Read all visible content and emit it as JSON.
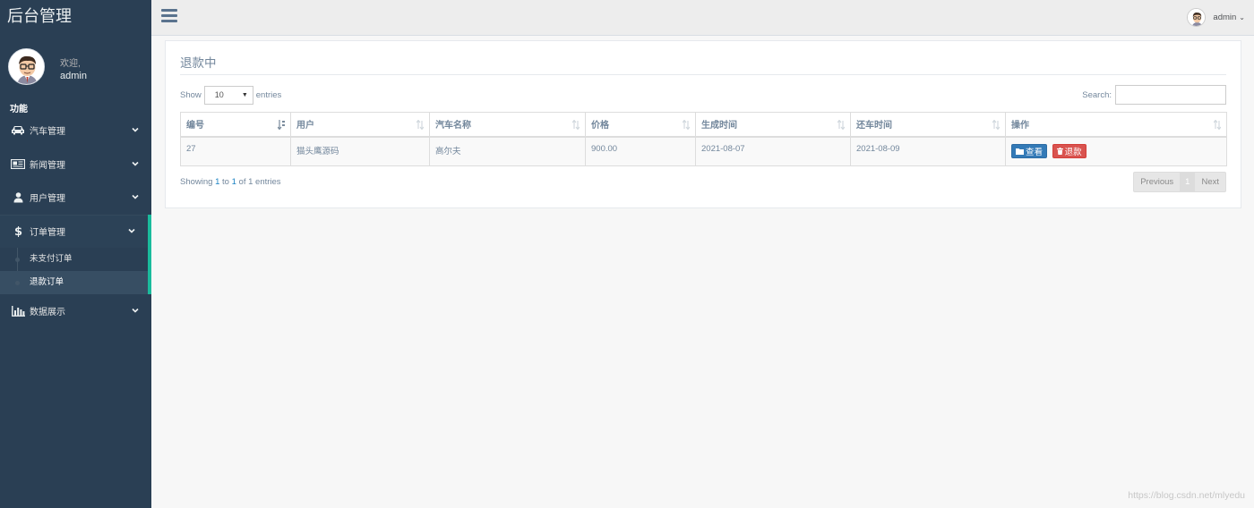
{
  "brand": {
    "title": "后台管理"
  },
  "profile": {
    "welcome": "欢迎,",
    "username": "admin"
  },
  "sidebar": {
    "section_title": "功能",
    "items": [
      {
        "label": "汽车管理",
        "icon": "car-icon"
      },
      {
        "label": "新闻管理",
        "icon": "newspaper-icon"
      },
      {
        "label": "用户管理",
        "icon": "user-icon"
      },
      {
        "label": "订单管理",
        "icon": "dollar-icon",
        "active": true,
        "children": [
          {
            "label": "未支付订单"
          },
          {
            "label": "退款订单",
            "current": true
          }
        ]
      },
      {
        "label": "数据展示",
        "icon": "bar-chart-icon"
      }
    ]
  },
  "topnav": {
    "user": "admin"
  },
  "panel": {
    "title": "退款中",
    "show_label": "Show",
    "entries_label": "entries",
    "page_size": "10",
    "search_label": "Search:",
    "search_value": "",
    "columns": [
      "编号",
      "用户",
      "汽车名称",
      "价格",
      "生成时间",
      "还车时间",
      "操作"
    ],
    "rows": [
      {
        "id": "27",
        "user": "猫头鹰源码",
        "car": "高尔夫",
        "price": "900.00",
        "created": "2021-08-07",
        "returned": "2021-08-09"
      }
    ],
    "actions": {
      "view": "查看",
      "refund": "退款"
    },
    "info": {
      "prefix": "Showing ",
      "from": "1",
      "to_word": " to ",
      "to": "1",
      "of_word": " of ",
      "total": "1",
      "suffix": " entries"
    },
    "pagination": {
      "previous": "Previous",
      "page": "1",
      "next": "Next"
    }
  },
  "watermark": "https://blog.csdn.net/mlyedu",
  "colors": {
    "sidebar": "#2a3f54",
    "accent": "#1abb9c",
    "view_button": "#337ab7",
    "refund_button": "#d9534f"
  }
}
